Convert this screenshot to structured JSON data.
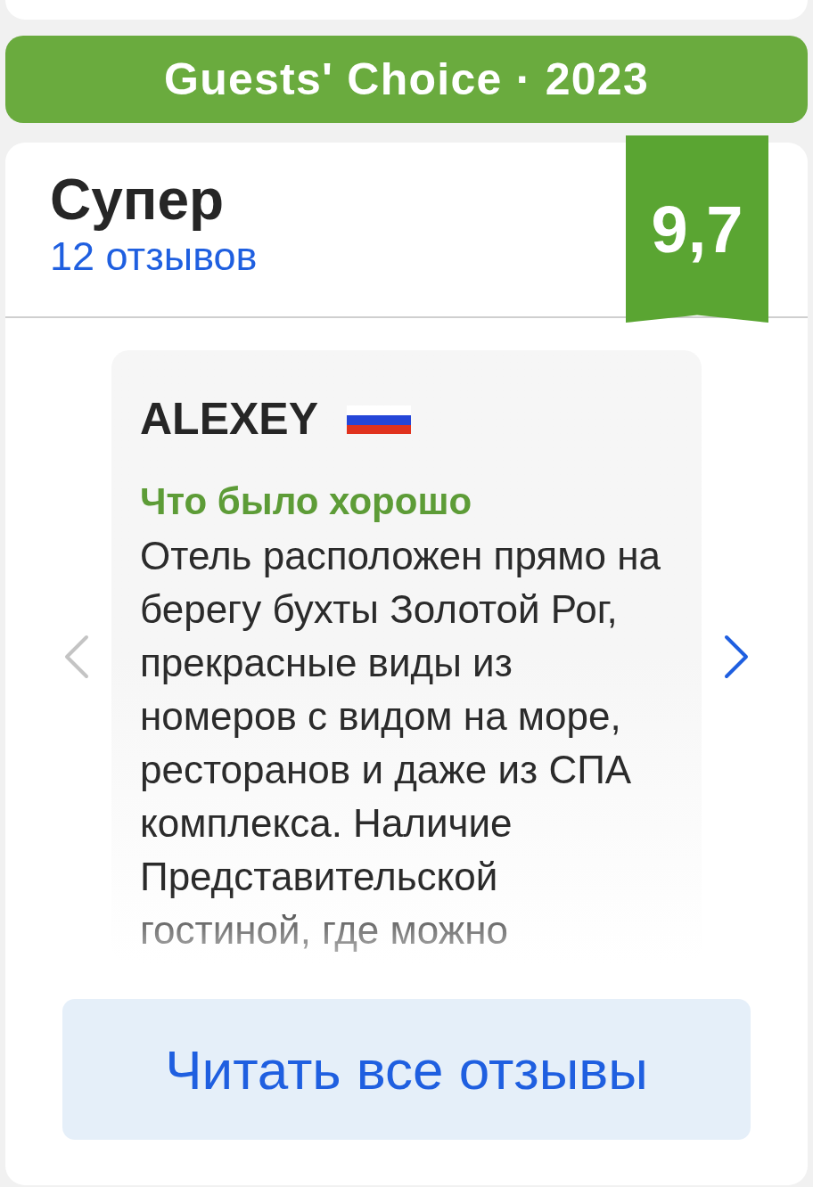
{
  "banner": {
    "title": "Guests' Choice · 2023"
  },
  "rating": {
    "label": "Супер",
    "reviews_link": "12 отзывов",
    "score": "9,7"
  },
  "review": {
    "author": "ALEXEY",
    "section_title": "Что было хорошо",
    "text": "Отель расположен прямо на берегу бухты Золотой Рог, прекрасные виды из номеров с видом на море, ресторанов и даже из СПА комплекса.  Наличие Представительской гостиной, где можно"
  },
  "carousel": {
    "prev_disabled": true,
    "next_disabled": false
  },
  "button": {
    "label": "Читать все отзывы"
  }
}
